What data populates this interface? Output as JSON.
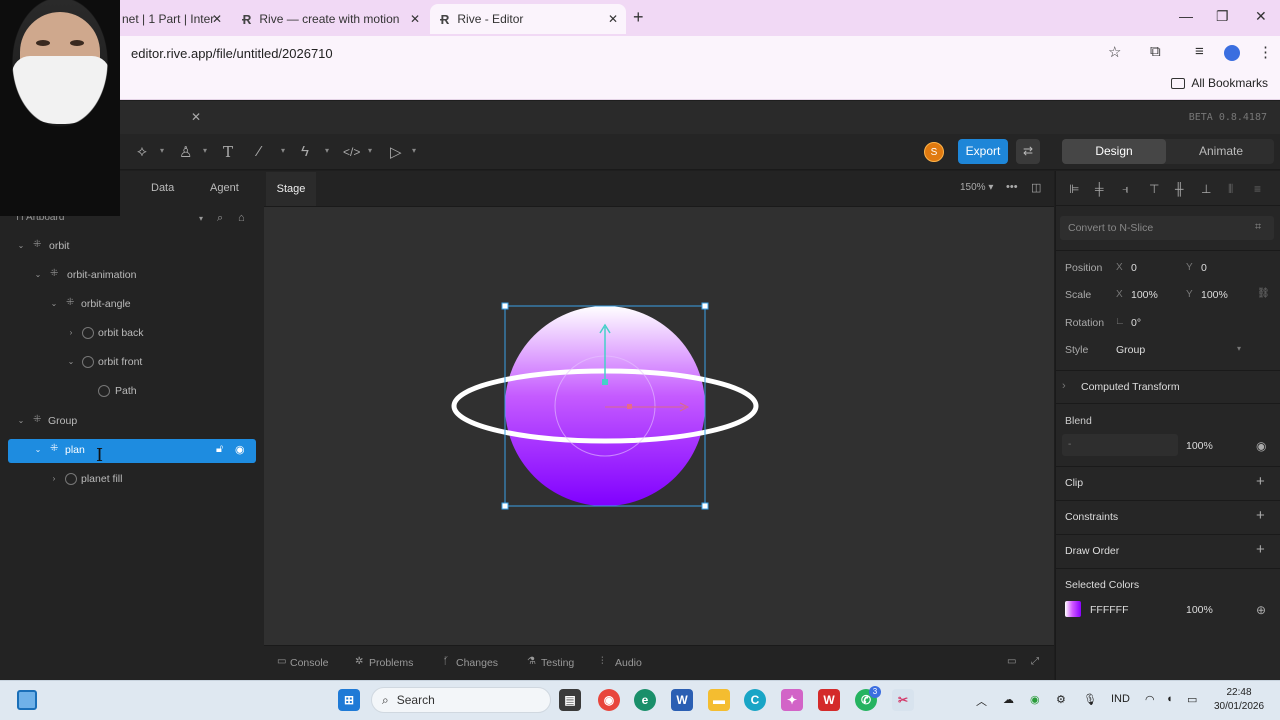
{
  "browser": {
    "tabs": [
      {
        "title": "net | 1 Part | Inter",
        "close": "✕"
      },
      {
        "title": "Rive — create with motion",
        "close": "✕"
      },
      {
        "title": "Rive - Editor",
        "close": "✕"
      }
    ],
    "url": "editor.rive.app/file/untitled/2026710",
    "bookmarks_label": "All Bookmarks"
  },
  "rive": {
    "version": "BETA 0.8.4187",
    "export_label": "Export",
    "mode_design": "Design",
    "mode_animate": "Animate",
    "avatar_initial": "S",
    "left_tabs": {
      "data": "Data",
      "agent": "Agent"
    },
    "artboard_label": "Artboard",
    "tree": [
      {
        "label": "orbit"
      },
      {
        "label": "orbit-animation"
      },
      {
        "label": "orbit-angle"
      },
      {
        "label": "orbit back"
      },
      {
        "label": "orbit front"
      },
      {
        "label": "Path"
      },
      {
        "label": "Group"
      },
      {
        "label": "plan"
      },
      {
        "label": "planet fill"
      }
    ],
    "stage_tab": "Stage",
    "zoom": "150%",
    "bottom_tabs": {
      "console": "Console",
      "problems": "Problems",
      "changes": "Changes",
      "testing": "Testing",
      "audio": "Audio"
    },
    "inspector": {
      "convert_nslice": "Convert to N-Slice",
      "position_label": "Position",
      "position_x": "0",
      "position_y": "0",
      "scale_label": "Scale",
      "scale_x": "100%",
      "scale_y": "100%",
      "rotation_label": "Rotation",
      "rotation_value": "0°",
      "style_label": "Style",
      "style_value": "Group",
      "computed_transform": "Computed Transform",
      "blend_label": "Blend",
      "blend_mode": "-",
      "blend_opacity": "100%",
      "clip_label": "Clip",
      "constraints_label": "Constraints",
      "draw_order_label": "Draw Order",
      "selected_colors_label": "Selected Colors",
      "color_hex": "FFFFFF",
      "color_opacity": "100%",
      "axis_x": "X",
      "axis_y": "Y"
    },
    "colors": {
      "accent": "#1e86d8",
      "selection": "#1e8ce0",
      "planet_top": "#ffffff",
      "planet_bottom": "#8b00ff"
    }
  },
  "taskbar": {
    "search": "Search",
    "language": "IND",
    "time": "22:48",
    "date": "30/01/2026",
    "whatsapp_badge": "3"
  }
}
